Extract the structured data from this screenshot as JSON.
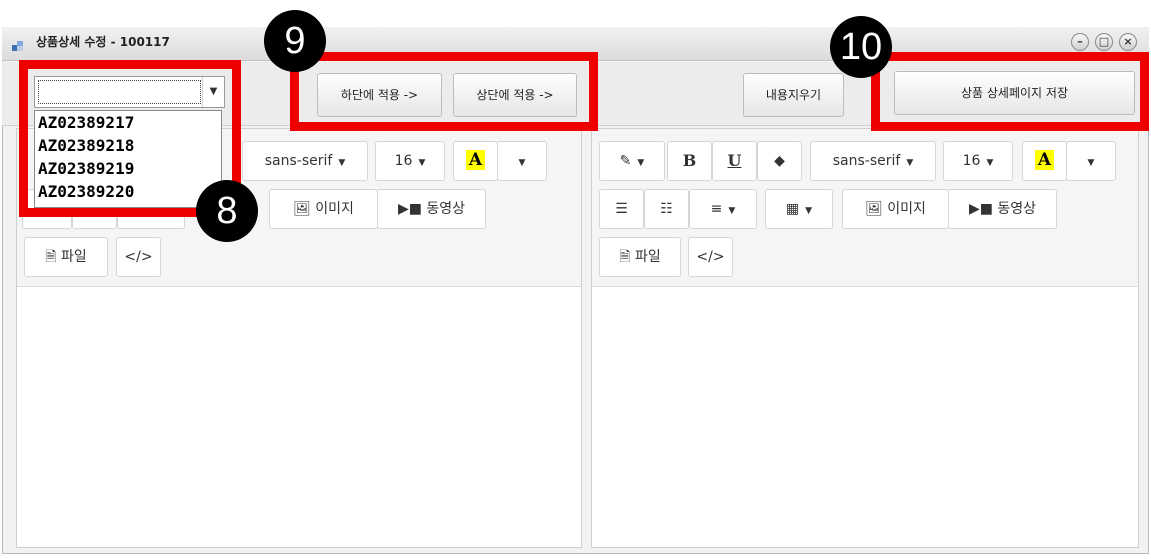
{
  "window": {
    "title": "상품상세 수정 - 100117",
    "controls": [
      "–",
      "□",
      "×"
    ]
  },
  "product_select": {
    "value": "",
    "options": [
      "AZ02389217",
      "AZ02389218",
      "AZ02389219",
      "AZ02389220"
    ]
  },
  "actions": {
    "apply_bottom": "하단에 적용 ->",
    "apply_top": "상단에 적용 ->",
    "clear_content": "내용지우기",
    "save_detail_page": "상품 상세페이지 저장"
  },
  "editor_toolbar": {
    "font_family": "sans-serif",
    "font_size": "16",
    "color_letter": "A",
    "bold": "B",
    "underline": "U",
    "image": "이미지",
    "video": "동영상",
    "file": "파일",
    "code": "</>"
  },
  "callouts": [
    "8",
    "9",
    "10"
  ],
  "colors": {
    "highlight_box": "#ee0000",
    "callout_bg": "#000000",
    "color_swatch": "#ffff00"
  }
}
